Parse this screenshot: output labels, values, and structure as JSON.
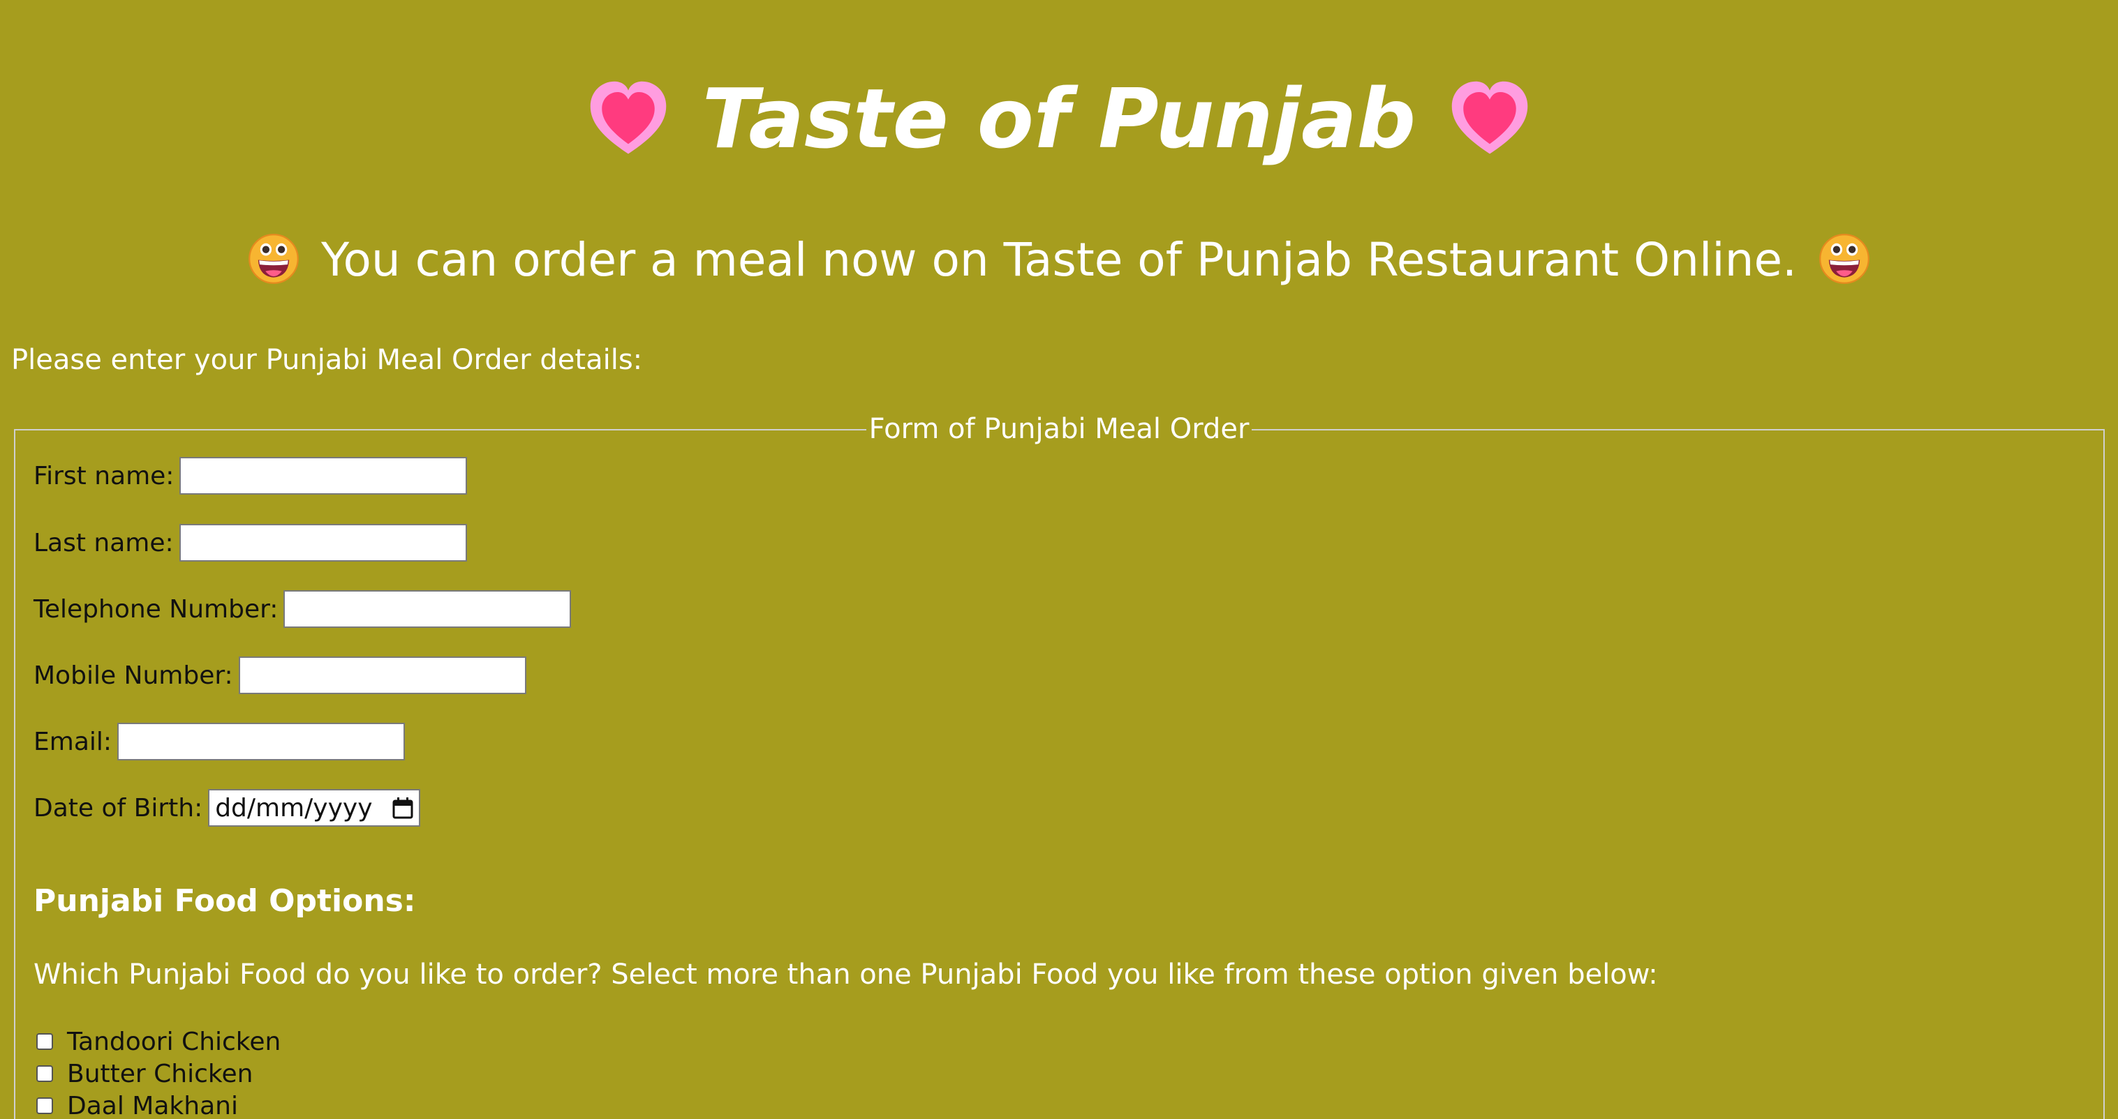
{
  "page": {
    "title": "Taste of Punjab",
    "subtitle": "You can order a meal now on Taste of Punjab Restaurant Online.",
    "intro": "Please enter your Punjabi Meal Order details:",
    "title_icon": "heart-icon",
    "subtitle_icon": "grinning-face-icon",
    "colors": {
      "background": "#a69d1e",
      "heading_text": "#ffffff",
      "field_text": "#111111"
    }
  },
  "form": {
    "legend": "Form of Punjabi Meal Order",
    "fields": {
      "first_name": {
        "label": "First name:",
        "value": ""
      },
      "last_name": {
        "label": "Last name:",
        "value": ""
      },
      "telephone": {
        "label": "Telephone Number:",
        "value": ""
      },
      "mobile": {
        "label": "Mobile Number:",
        "value": ""
      },
      "email": {
        "label": "Email:",
        "value": ""
      },
      "dob": {
        "label": "Date of Birth:",
        "placeholder": "dd/mm/yyyy"
      }
    },
    "food_section": {
      "heading": "Punjabi Food Options:",
      "question": "Which Punjabi Food do you like to order? Select more than one Punjabi Food you like from these option given below:",
      "options": [
        {
          "label": "Tandoori Chicken",
          "checked": false
        },
        {
          "label": "Butter Chicken",
          "checked": false
        },
        {
          "label": "Daal Makhani",
          "checked": false
        }
      ]
    }
  }
}
